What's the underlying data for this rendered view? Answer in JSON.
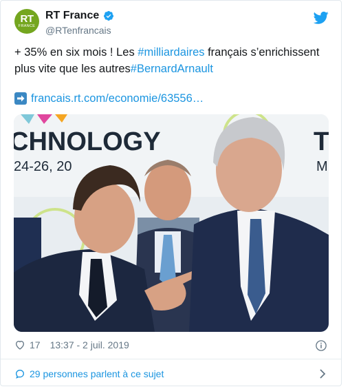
{
  "account": {
    "name": "RT France",
    "handle": "@RTenfrancais",
    "avatar_text": "RT",
    "avatar_subtext": "FRANCE",
    "brand_color": "#74a61f",
    "verified_icon": "verified-badge-icon"
  },
  "tweet": {
    "text_part1": "+ 35% en six mois ! Les ",
    "hashtag1": "#milliardaires",
    "text_part2": " français s’enrichissent plus vite que les autres",
    "hashtag2": "#BernardArnault",
    "url_icon": "arrow-right-icon",
    "url": "francais.rt.com/economie/63556…",
    "link_color": "#1b95e0"
  },
  "photo": {
    "banner_text": "CHNOLOGY",
    "banner_dates": "24-26, 20",
    "banner_right_letter": "T",
    "banner_right_small": "M"
  },
  "stats": {
    "likes": "17",
    "timestamp": "13:37 - 2 juil. 2019"
  },
  "footer": {
    "conversation": "29 personnes parlent à ce sujet"
  }
}
